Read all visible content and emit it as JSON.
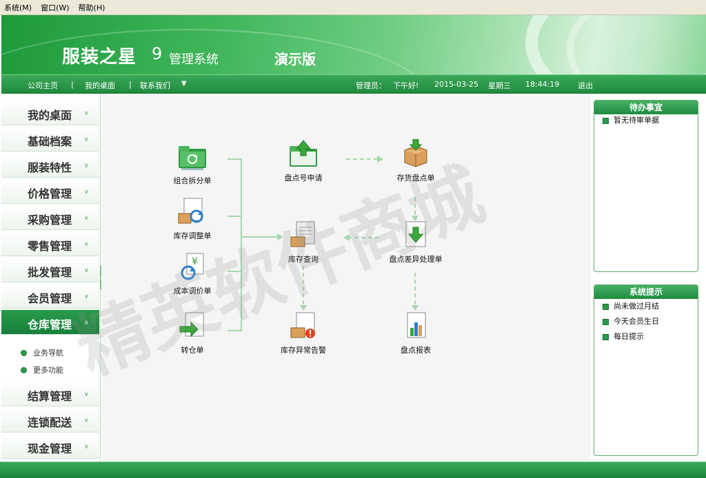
{
  "menubar": [
    "系统(M)",
    "窗口(W)",
    "帮助(H)"
  ],
  "banner": {
    "brand": "服装之星",
    "version": "9",
    "subtitle": "管理系统",
    "edition": "演示版"
  },
  "nav": {
    "home": "公司主页",
    "sep1": "|",
    "desktop": "我的桌面",
    "sep2": "|",
    "contact": "联系我们",
    "contact_arrow": "▼",
    "admin_label": "管理员：",
    "greeting": "下午好!",
    "date": "2015-03-25",
    "weekday": "星期三",
    "time": "18:44:19",
    "logout": "退出"
  },
  "sidebar": {
    "items": [
      {
        "label": "我的桌面"
      },
      {
        "label": "基础档案"
      },
      {
        "label": "服装特性"
      },
      {
        "label": "价格管理"
      },
      {
        "label": "采购管理"
      },
      {
        "label": "零售管理"
      },
      {
        "label": "批发管理"
      },
      {
        "label": "会员管理"
      },
      {
        "label": "仓库管理"
      },
      {
        "label": "结算管理"
      },
      {
        "label": "连锁配送"
      },
      {
        "label": "现金管理"
      }
    ],
    "active_index": 8,
    "subitems": [
      "业务导航",
      "更多功能"
    ]
  },
  "flow": {
    "combo_split": "组合拆分单",
    "stock_adjust": "库存调整单",
    "cost_adjust": "成本调价单",
    "transfer": "转仓单",
    "count_apply": "盘点号申请",
    "stock_query": "库存查询",
    "stock_alert": "库存异常告警",
    "inventory_count": "存货盘点单",
    "diff_process": "盘点差异处理单",
    "count_report": "盘点报表"
  },
  "todo": {
    "title": "待办事宜",
    "items": [
      "暂无待审单据"
    ]
  },
  "tips": {
    "title": "系统提示",
    "items": [
      "尚未做过月结",
      "今天会员生日",
      "每日提示"
    ]
  },
  "watermark": "精英软件商城",
  "colors": {
    "accent": "#1f8b3e",
    "light": "#a5d8ad"
  }
}
